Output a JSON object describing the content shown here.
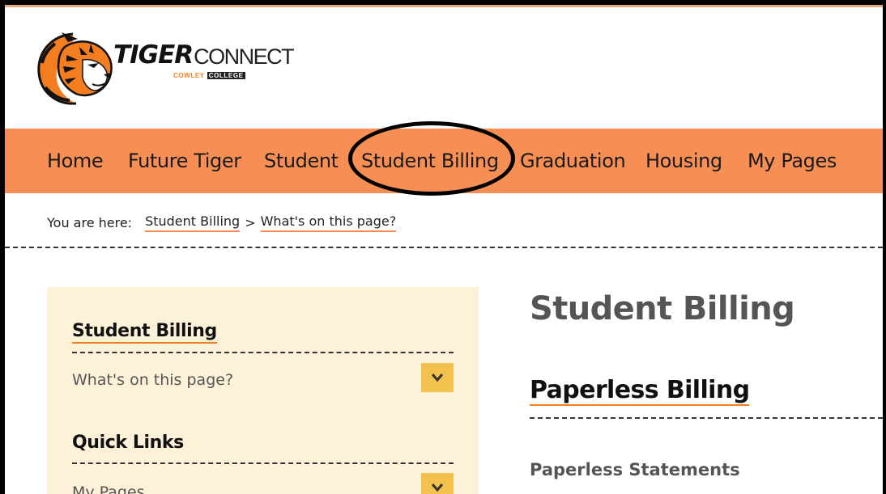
{
  "logo": {
    "word_tiger": "TIGER",
    "word_connect": "CONNECT",
    "sub_cowley": "COWLEY",
    "sub_college": "COLLEGE",
    "brand_color": "#f47d20"
  },
  "nav": {
    "color": "#f78f55",
    "items": [
      {
        "label": "Home"
      },
      {
        "label": "Future Tiger"
      },
      {
        "label": "Student"
      },
      {
        "label": "Student Billing"
      },
      {
        "label": "Graduation"
      },
      {
        "label": "Housing"
      },
      {
        "label": "My Pages"
      }
    ]
  },
  "breadcrumb": {
    "prefix": "You are here:",
    "items": [
      "Student Billing",
      "What's on this page?"
    ],
    "separator": ">"
  },
  "sidebar": {
    "sections": [
      {
        "heading": "Student Billing",
        "link": "What's on this page?",
        "icon": "chevron-down-icon"
      },
      {
        "heading": "Quick Links",
        "link": "My Pages",
        "icon": "chevron-down-icon"
      }
    ]
  },
  "main": {
    "title": "Student Billing",
    "section_title": "Paperless Billing",
    "sub_title": "Paperless Statements"
  }
}
